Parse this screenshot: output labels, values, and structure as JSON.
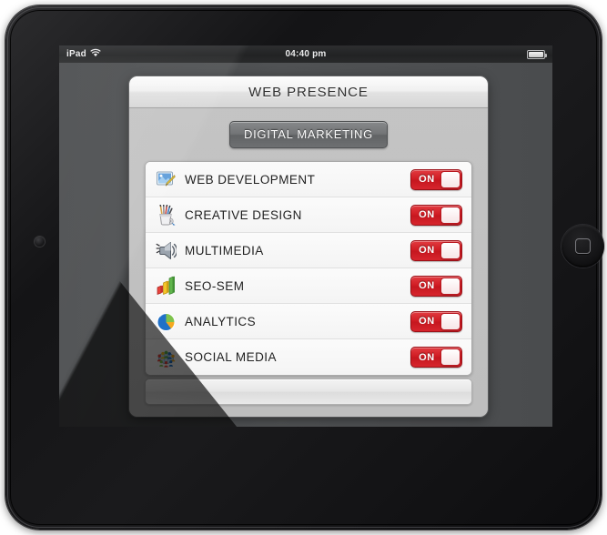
{
  "device": {
    "home_button_name": "home-button",
    "camera_name": "front-camera"
  },
  "statusbar": {
    "device_label": "iPad",
    "wifi_icon": "wifi-icon",
    "time": "04:40 pm",
    "battery_icon": "battery-icon"
  },
  "app": {
    "title": "WEB PRESENCE",
    "section_button": "DIGITAL MARKETING",
    "services": [
      {
        "label": "WEB DEVELOPMENT",
        "icon": "document-pencil-icon",
        "toggle": "ON"
      },
      {
        "label": "CREATIVE DESIGN",
        "icon": "brush-cup-icon",
        "toggle": "ON"
      },
      {
        "label": "MULTIMEDIA",
        "icon": "speaker-icon",
        "toggle": "ON"
      },
      {
        "label": "SEO-SEM",
        "icon": "bar-chart-icon",
        "toggle": "ON"
      },
      {
        "label": "ANALYTICS",
        "icon": "pie-chart-icon",
        "toggle": "ON"
      },
      {
        "label": "SOCIAL MEDIA",
        "icon": "people-globe-icon",
        "toggle": "ON"
      }
    ]
  },
  "colors": {
    "toggle_on_red": "#cf1820",
    "panel_gray": "#bdbdbd",
    "screen_gray": "#4b4d4f",
    "section_button_gray": "#6c6e70"
  }
}
